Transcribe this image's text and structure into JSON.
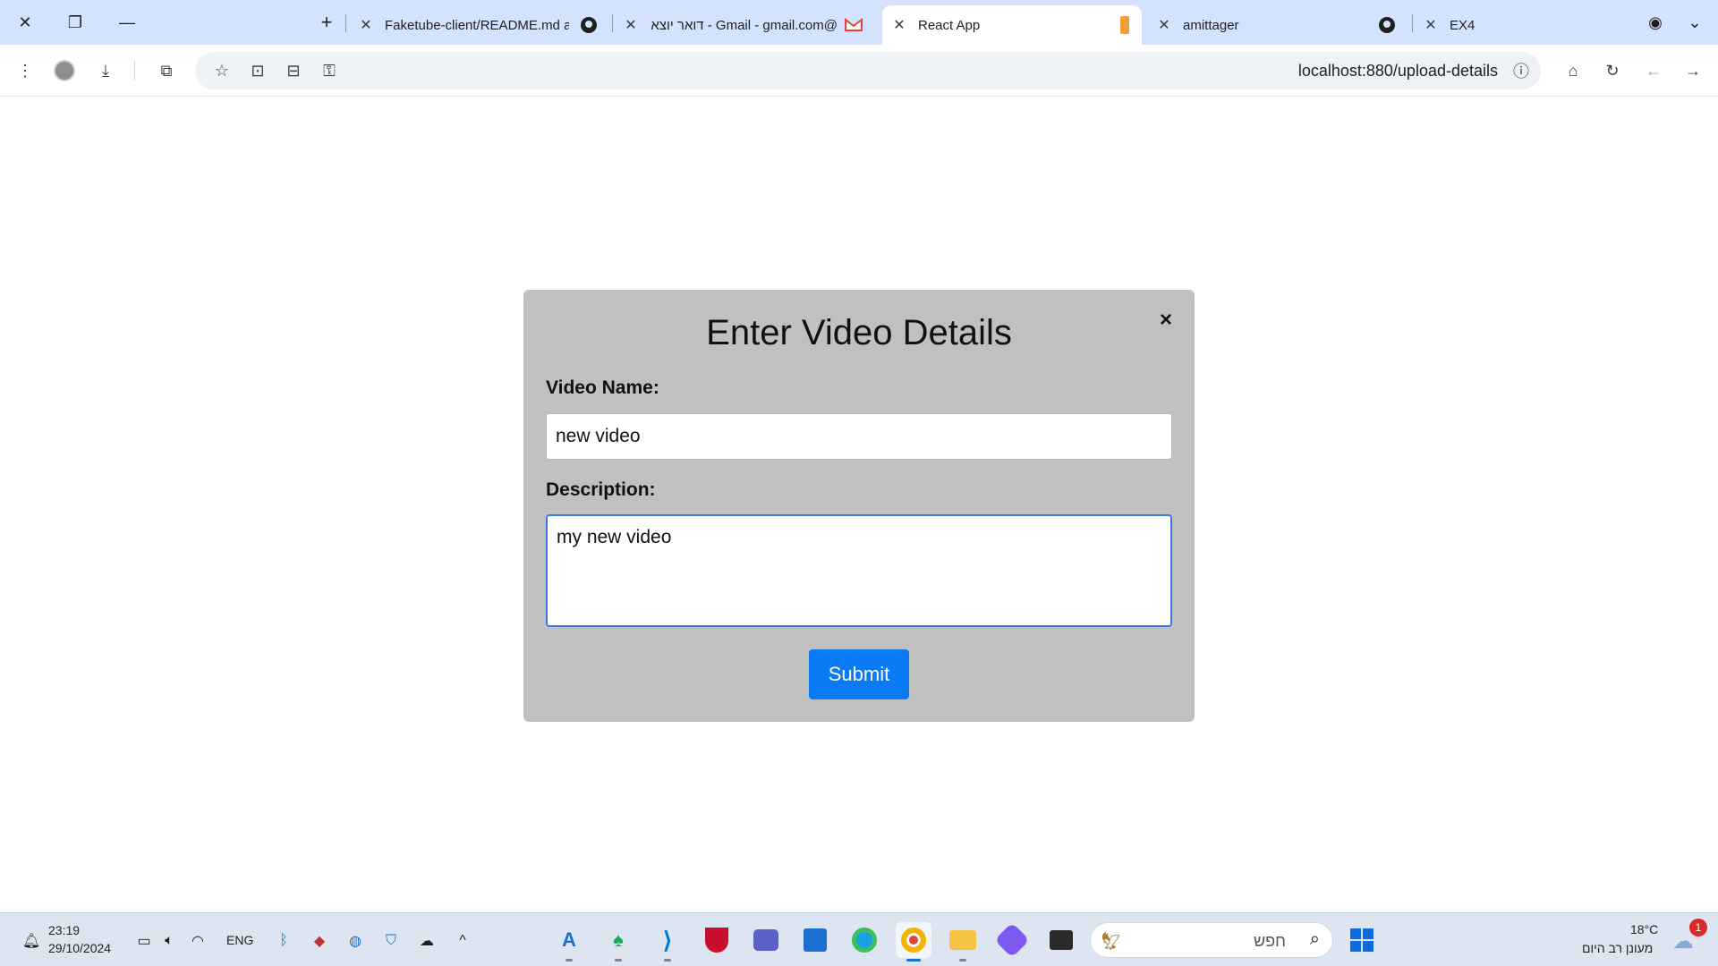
{
  "browser": {
    "tabs": [
      {
        "title": "Faketube-client/README.md at",
        "icon": "github-icon"
      },
      {
        "title": "דואר יוצא - Gmail - gmail.com@",
        "icon": "gmail-icon"
      },
      {
        "title": "React App",
        "icon": "react-icon",
        "active": true
      },
      {
        "title": "amittager",
        "icon": "github-icon"
      },
      {
        "title": "EX4",
        "icon": "none"
      }
    ],
    "url": "localhost:880/upload-details"
  },
  "modal": {
    "title": "Enter Video Details",
    "close_glyph": "×",
    "video_name_label": "Video Name:",
    "video_name_value": "new video",
    "description_label": "Description:",
    "description_value": "my new video",
    "submit_label": "Submit"
  },
  "taskbar": {
    "time": "23:19",
    "date": "29/10/2024",
    "language": "ENG",
    "search_placeholder": "חפש",
    "weather_temp": "18°C",
    "weather_desc": "מעונן רב היום",
    "notification_count": "1"
  },
  "colors": {
    "tab_strip": "#d3e3fd",
    "modal_bg": "#c0c0c0",
    "submit_bg": "#0a7bf5",
    "focus_border": "#3b78e7"
  }
}
